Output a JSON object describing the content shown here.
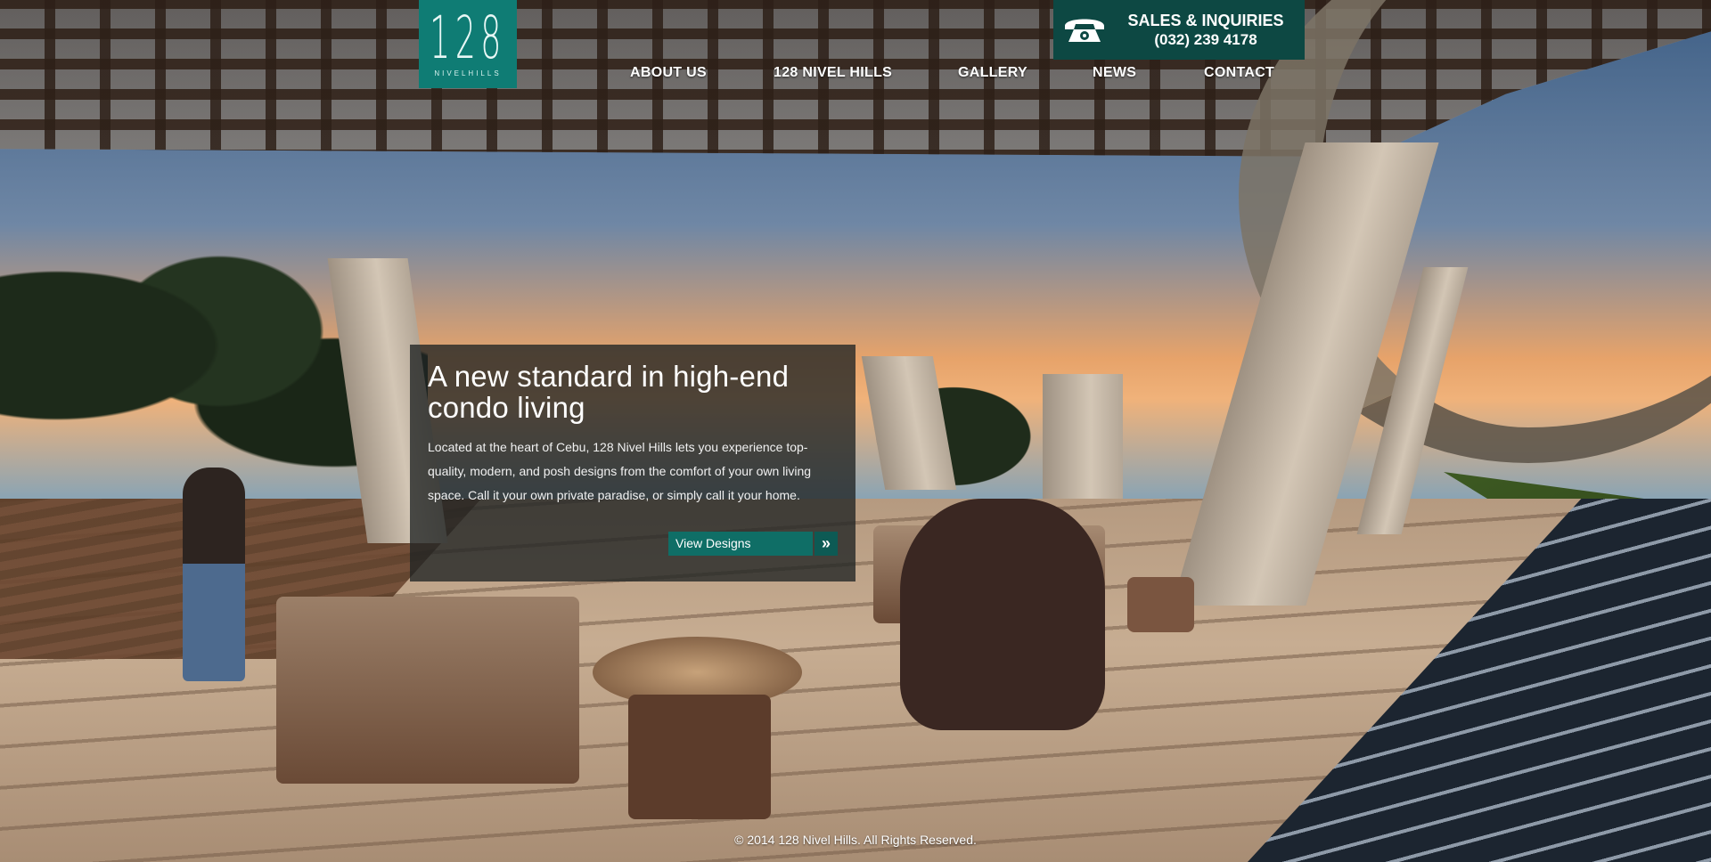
{
  "logo": {
    "number": "128",
    "subtitle": "NIVELHILLS"
  },
  "sales": {
    "icon": "telephone-icon",
    "title": "SALES & INQUIRIES",
    "number": "(032) 239 4178"
  },
  "nav": {
    "items": [
      {
        "label": "ABOUT US"
      },
      {
        "label": "128 NIVEL HILLS"
      },
      {
        "label": "GALLERY"
      },
      {
        "label": "NEWS"
      },
      {
        "label": "CONTACT"
      }
    ]
  },
  "hero": {
    "title": "A new standard in high-end condo living",
    "body": "Located at the heart of Cebu, 128 Nivel Hills lets you experience top-quality, modern, and posh designs from the comfort of your own living space. Call it your own private paradise, or simply call it your home.",
    "button_label": "View Designs",
    "button_icon": "double-chevron-right-icon"
  },
  "footer": {
    "copyright": "© 2014 128 Nivel Hills. All Rights Reserved."
  },
  "colors": {
    "brand_teal": "#0f7c74",
    "sales_bg": "#0d4843",
    "button_bg": "#0f6e66"
  }
}
